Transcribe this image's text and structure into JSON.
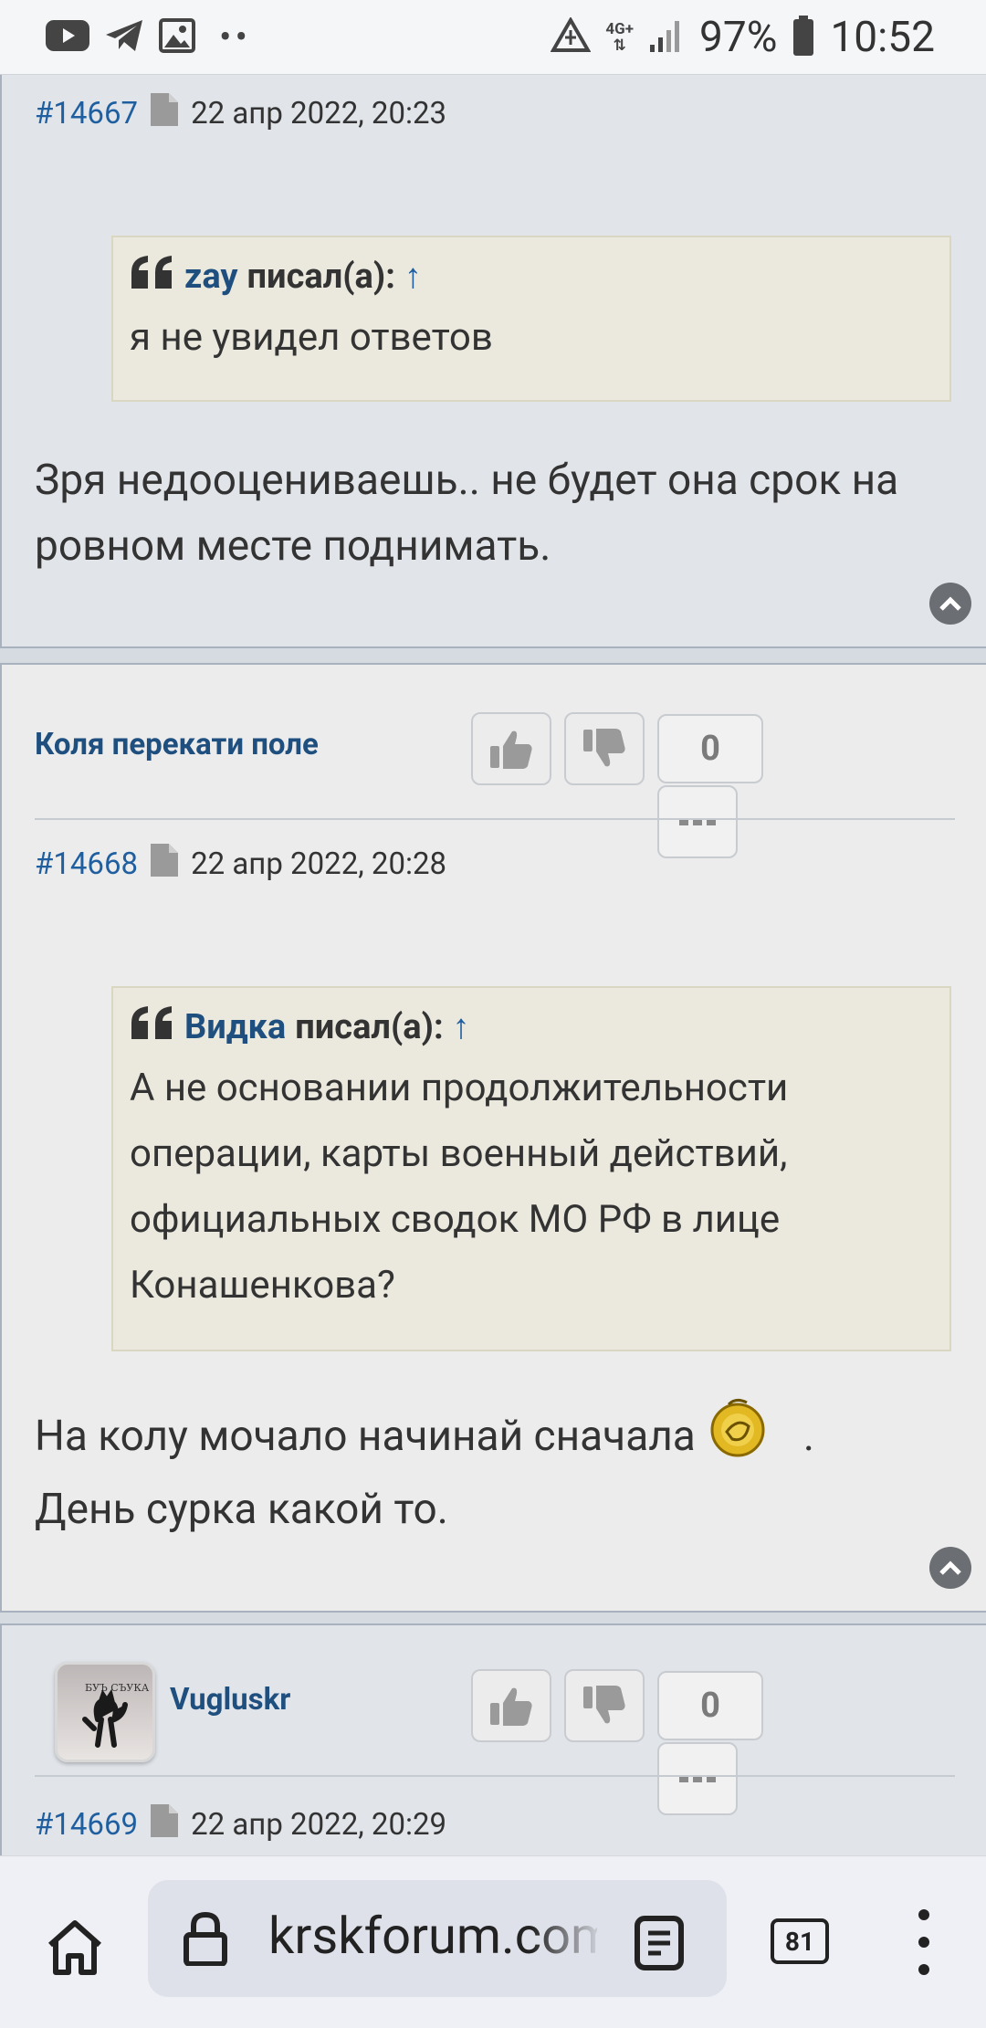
{
  "status_bar": {
    "network": "4G+",
    "battery": "97%",
    "time": "10:52"
  },
  "posts": [
    {
      "number": "#14667",
      "date": "22 апр 2022, 20:23",
      "quote": {
        "author": "zay",
        "wrote": "писал(а):",
        "arrow": "↑",
        "text": "я не увидел ответов"
      },
      "body": "Зря недооцениваешь.. не будет она срок на ровном месте поднимать."
    },
    {
      "author": "Коля перекати поле",
      "score": "0",
      "number": "#14668",
      "date": "22 апр 2022, 20:28",
      "quote": {
        "author": "Видка",
        "wrote": "писал(а):",
        "arrow": "↑",
        "text": "А не основании продолжительности операции, карты военный действий, официальных сводок МО РФ в лице Конашенкова?"
      },
      "body_line1": "На колу мочало начинай сначала",
      "body_dot": ".",
      "body_line2": "День сурка какой то."
    },
    {
      "author": "Vugluskr",
      "avatar_text": "БУЪ СЪУКА",
      "score": "0",
      "number": "#14669",
      "date": "22 апр 2022, 20:29"
    }
  ],
  "browser": {
    "url": "krskforum.com",
    "tab_count": "81"
  }
}
